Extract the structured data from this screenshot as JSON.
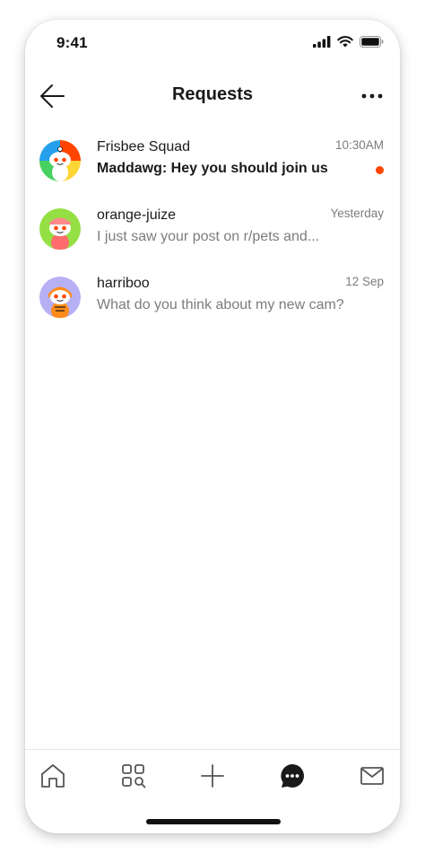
{
  "status_bar": {
    "time": "9:41"
  },
  "header": {
    "title": "Requests"
  },
  "requests": [
    {
      "name": "Frisbee Squad",
      "preview": "Maddawg: Hey you should join us",
      "time": "10:30AM",
      "unread": true
    },
    {
      "name": "orange-juize",
      "preview": "I just saw your post on r/pets and...",
      "time": "Yesterday",
      "unread": false
    },
    {
      "name": "harriboo",
      "preview": "What do you think about my new cam?",
      "time": "12 Sep",
      "unread": false
    }
  ],
  "tab_bar": {
    "items": [
      "home-icon",
      "discover-icon",
      "create-post-icon",
      "chat-icon",
      "inbox-icon"
    ],
    "active": "chat-icon"
  },
  "colors": {
    "accent": "#ff4500",
    "text": "#1a1a1b",
    "muted": "#7c7c7c"
  }
}
